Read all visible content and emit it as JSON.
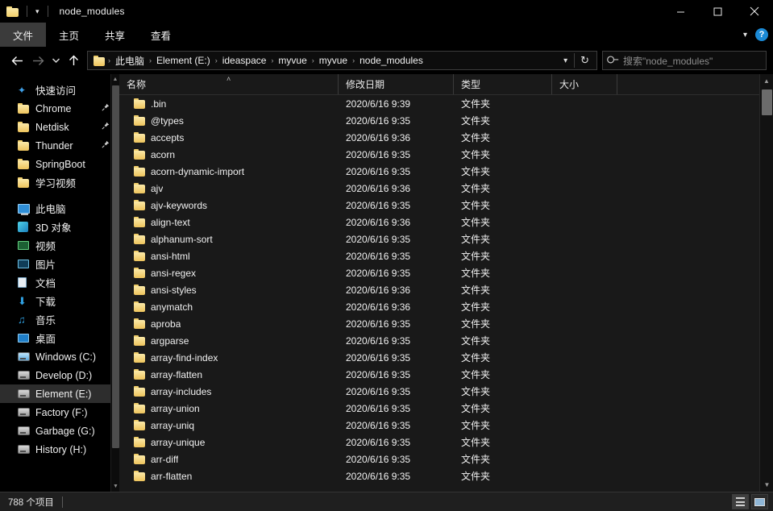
{
  "window": {
    "title": "node_modules",
    "qat_folder_icon": "folder-icon",
    "qat_dropdown_icon": "chevron-down-icon",
    "minimize_label": "—",
    "maximize_label": "□",
    "close_label": "✕"
  },
  "ribbon": {
    "tabs": [
      {
        "label": "文件",
        "active": true
      },
      {
        "label": "主页",
        "active": false
      },
      {
        "label": "共享",
        "active": false
      },
      {
        "label": "查看",
        "active": false
      }
    ],
    "expand_icon": "chevron-down-icon",
    "help_label": "?"
  },
  "addressbar": {
    "back_icon": "arrow-left-icon",
    "forward_icon": "arrow-right-icon",
    "recent_icon": "chevron-down-icon",
    "up_icon": "arrow-up-icon",
    "crumbs": [
      "此电脑",
      "Element (E:)",
      "ideaspace",
      "myvue",
      "myvue",
      "node_modules"
    ],
    "separator": "›",
    "dropdown_icon": "chevron-down-icon",
    "refresh_icon": "refresh-icon",
    "refresh_glyph": "↻",
    "search_icon": "search-icon",
    "search_placeholder": "搜索\"node_modules\"",
    "search_value": ""
  },
  "sidebar": {
    "groups": [
      {
        "header": {
          "label": "快速访问",
          "icon": "star-icon"
        },
        "items": [
          {
            "label": "Chrome",
            "icon": "folder-icon",
            "pinned": true
          },
          {
            "label": "Netdisk",
            "icon": "folder-icon",
            "pinned": true
          },
          {
            "label": "Thunder",
            "icon": "folder-icon",
            "pinned": true
          },
          {
            "label": "SpringBoot",
            "icon": "folder-icon",
            "pinned": false
          },
          {
            "label": "学习视频",
            "icon": "folder-icon",
            "pinned": false
          }
        ]
      },
      {
        "header": {
          "label": "此电脑",
          "icon": "computer-icon"
        },
        "items": [
          {
            "label": "3D 对象",
            "icon": "cube-icon",
            "pinned": false
          },
          {
            "label": "视频",
            "icon": "video-icon",
            "pinned": false
          },
          {
            "label": "图片",
            "icon": "picture-icon",
            "pinned": false
          },
          {
            "label": "文档",
            "icon": "document-icon",
            "pinned": false
          },
          {
            "label": "下载",
            "icon": "download-icon",
            "pinned": false
          },
          {
            "label": "音乐",
            "icon": "music-icon",
            "pinned": false
          },
          {
            "label": "桌面",
            "icon": "desktop-icon",
            "pinned": false
          },
          {
            "label": "Windows (C:)",
            "icon": "drive-windows-icon",
            "pinned": false
          },
          {
            "label": "Develop (D:)",
            "icon": "drive-icon",
            "pinned": false
          },
          {
            "label": "Element (E:)",
            "icon": "drive-icon",
            "pinned": false,
            "selected": true
          },
          {
            "label": "Factory (F:)",
            "icon": "drive-icon",
            "pinned": false
          },
          {
            "label": "Garbage (G:)",
            "icon": "drive-icon",
            "pinned": false
          },
          {
            "label": "History (H:)",
            "icon": "drive-icon",
            "pinned": false
          }
        ]
      }
    ],
    "pin_icon": "pin-icon",
    "pin_glyph": "📌",
    "scroll_up_icon": "chevron-up-icon",
    "scroll_down_icon": "chevron-down-icon"
  },
  "filelist": {
    "columns": [
      {
        "label": "名称",
        "key": "name",
        "sorted": "asc"
      },
      {
        "label": "修改日期",
        "key": "date"
      },
      {
        "label": "类型",
        "key": "type"
      },
      {
        "label": "大小",
        "key": "size"
      }
    ],
    "sort_indicator": "˄",
    "rows": [
      {
        "name": ".bin",
        "date": "2020/6/16 9:39",
        "type": "文件夹",
        "size": ""
      },
      {
        "name": "@types",
        "date": "2020/6/16 9:35",
        "type": "文件夹",
        "size": ""
      },
      {
        "name": "accepts",
        "date": "2020/6/16 9:36",
        "type": "文件夹",
        "size": ""
      },
      {
        "name": "acorn",
        "date": "2020/6/16 9:35",
        "type": "文件夹",
        "size": ""
      },
      {
        "name": "acorn-dynamic-import",
        "date": "2020/6/16 9:35",
        "type": "文件夹",
        "size": ""
      },
      {
        "name": "ajv",
        "date": "2020/6/16 9:36",
        "type": "文件夹",
        "size": ""
      },
      {
        "name": "ajv-keywords",
        "date": "2020/6/16 9:35",
        "type": "文件夹",
        "size": ""
      },
      {
        "name": "align-text",
        "date": "2020/6/16 9:36",
        "type": "文件夹",
        "size": ""
      },
      {
        "name": "alphanum-sort",
        "date": "2020/6/16 9:35",
        "type": "文件夹",
        "size": ""
      },
      {
        "name": "ansi-html",
        "date": "2020/6/16 9:35",
        "type": "文件夹",
        "size": ""
      },
      {
        "name": "ansi-regex",
        "date": "2020/6/16 9:35",
        "type": "文件夹",
        "size": ""
      },
      {
        "name": "ansi-styles",
        "date": "2020/6/16 9:36",
        "type": "文件夹",
        "size": ""
      },
      {
        "name": "anymatch",
        "date": "2020/6/16 9:36",
        "type": "文件夹",
        "size": ""
      },
      {
        "name": "aproba",
        "date": "2020/6/16 9:35",
        "type": "文件夹",
        "size": ""
      },
      {
        "name": "argparse",
        "date": "2020/6/16 9:35",
        "type": "文件夹",
        "size": ""
      },
      {
        "name": "array-find-index",
        "date": "2020/6/16 9:35",
        "type": "文件夹",
        "size": ""
      },
      {
        "name": "array-flatten",
        "date": "2020/6/16 9:35",
        "type": "文件夹",
        "size": ""
      },
      {
        "name": "array-includes",
        "date": "2020/6/16 9:35",
        "type": "文件夹",
        "size": ""
      },
      {
        "name": "array-union",
        "date": "2020/6/16 9:35",
        "type": "文件夹",
        "size": ""
      },
      {
        "name": "array-uniq",
        "date": "2020/6/16 9:35",
        "type": "文件夹",
        "size": ""
      },
      {
        "name": "array-unique",
        "date": "2020/6/16 9:35",
        "type": "文件夹",
        "size": ""
      },
      {
        "name": "arr-diff",
        "date": "2020/6/16 9:35",
        "type": "文件夹",
        "size": ""
      },
      {
        "name": "arr-flatten",
        "date": "2020/6/16 9:35",
        "type": "文件夹",
        "size": ""
      }
    ],
    "folder_icon": "folder-icon",
    "scroll_up_icon": "chevron-up-icon",
    "scroll_down_icon": "chevron-down-icon"
  },
  "statusbar": {
    "item_count": "788 个项目",
    "view_details_icon": "details-view-icon",
    "view_tiles_icon": "large-icons-view-icon"
  },
  "colors": {
    "window_bg": "#000000",
    "file_pane_bg": "#191919",
    "status_bg": "#1f1f1f",
    "accent_folder": "#f2cf6a",
    "accent_blue": "#1b8ad6",
    "selection": "#2d2d2d",
    "text": "#f0f0f0",
    "muted_text": "#8d8d8d"
  }
}
